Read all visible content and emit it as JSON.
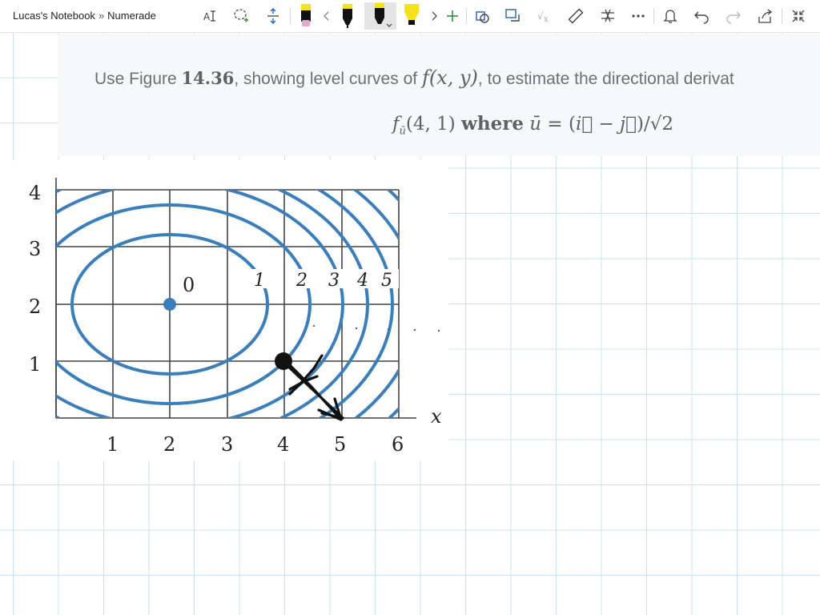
{
  "breadcrumb": {
    "notebook": "Lucas's Notebook",
    "separator": "»",
    "section": "Numerade"
  },
  "toolbar": {
    "icons": [
      "type-text-icon",
      "lasso-select-icon",
      "add-space-icon",
      "pen-pink-icon",
      "scroll-left-icon",
      "pen-black-icon",
      "pen-black-selected-icon",
      "highlighter-yellow-icon",
      "scroll-right-icon",
      "add-pen-icon",
      "shapes-icon",
      "ink-to-shape-icon",
      "ink-to-math-icon",
      "ruler-icon",
      "ink-to-text-icon",
      "more-icon",
      "notifications-icon",
      "undo-icon",
      "redo-icon",
      "share-icon",
      "collapse-icon"
    ],
    "colors": {
      "pen_pink": "#e3a5c9",
      "pen_black": "#111111",
      "highlighter_yellow": "#f6e21a",
      "add_green": "#1e9b3a"
    }
  },
  "question": {
    "pre": "Use Figure",
    "fig_num": "14.36",
    "mid": ", showing level curves of",
    "func": "f(x, y)",
    "post": ", to estimate the directional derivat",
    "line2_f": "f",
    "line2_sub": "ū",
    "line2_point": "(4, 1)",
    "line2_where": "where",
    "line2_u": "ū",
    "line2_eq": "= (",
    "line2_i": "i⃗",
    "line2_minus": "−",
    "line2_j": "j⃗",
    "line2_close": ")/√2"
  },
  "figure": {
    "x_axis_label": "x",
    "x_ticks": [
      "1",
      "2",
      "3",
      "4",
      "5",
      "6"
    ],
    "y_ticks": [
      "1",
      "2",
      "3",
      "4"
    ],
    "center_label": "0",
    "level_labels": [
      "1",
      "2",
      "3",
      "4",
      "5"
    ],
    "curve_color": "#3a7fbd",
    "ink_color": "#111111"
  }
}
